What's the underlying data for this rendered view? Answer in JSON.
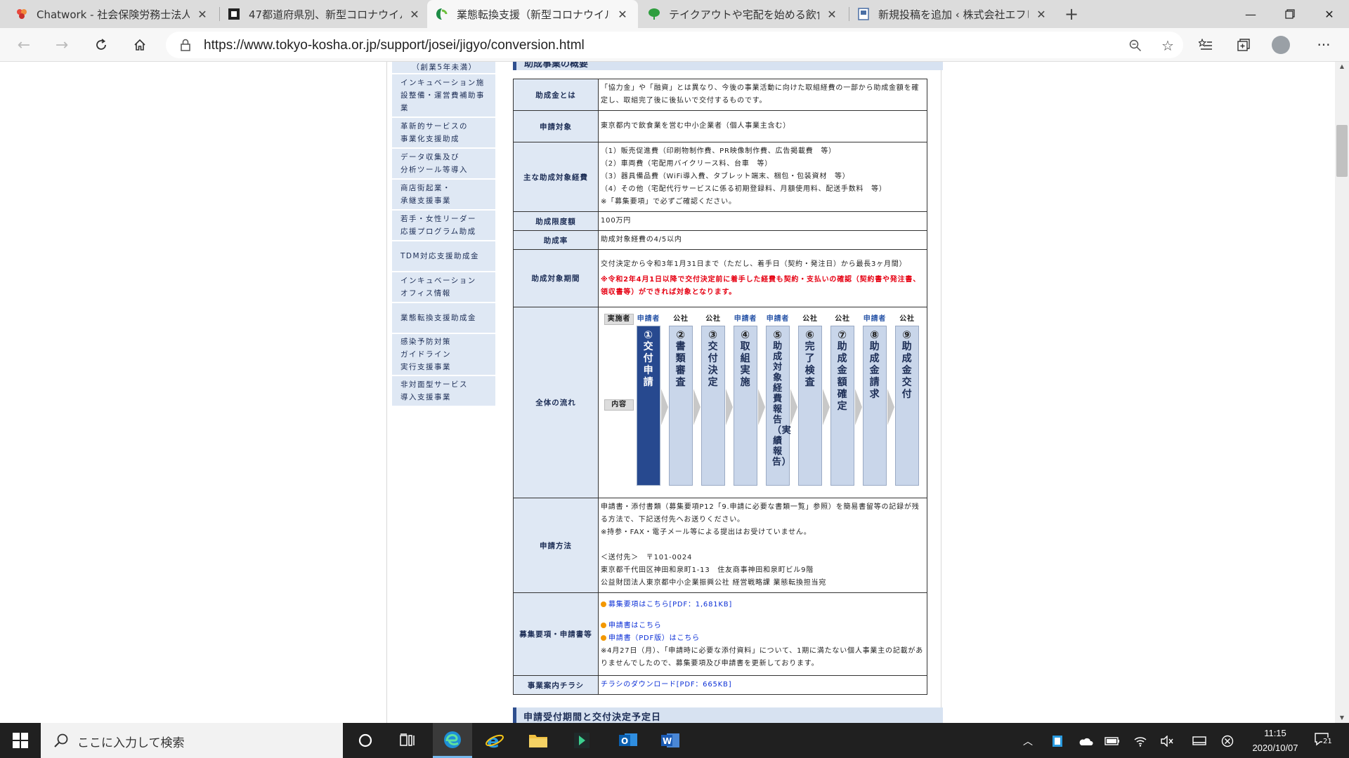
{
  "browser": {
    "tabs": [
      {
        "title": "Chatwork - 社会保険労務士法人い",
        "icon": "chatwork-icon"
      },
      {
        "title": "47都道府県別、新型コロナウイルス",
        "icon": "square-favicon-icon"
      },
      {
        "title": "業態転換支援（新型コロナウイルス",
        "icon": "kosha-favicon-icon"
      },
      {
        "title": "テイクアウトや宅配を始める飲食店の",
        "icon": "green-leaf-icon"
      },
      {
        "title": "新規投稿を追加 ‹ 株式会社エフピー",
        "icon": "document-favicon-icon"
      }
    ],
    "url": "https://www.tokyo-kosha.or.jp/support/josei/jigyo/conversion.html"
  },
  "sidebar": {
    "items": [
      {
        "lines": [
          "（創業5年未満）"
        ]
      },
      {
        "lines": [
          "インキュベーション施",
          "設整備・運営費補助事",
          "業"
        ]
      },
      {
        "lines": [
          "革新的サービスの",
          "事業化支援助成"
        ]
      },
      {
        "lines": [
          "データ収集及び",
          "分析ツール等導入"
        ]
      },
      {
        "lines": [
          "商店街起業・",
          "承継支援事業"
        ]
      },
      {
        "lines": [
          "若手・女性リーダー",
          "応援プログラム助成"
        ]
      },
      {
        "lines": [
          "TDM対応支援助成金"
        ]
      },
      {
        "lines": [
          "インキュベーション",
          "オフィス情報"
        ]
      },
      {
        "lines": [
          "業態転換支援助成金"
        ]
      },
      {
        "lines": [
          "感染予防対策",
          "ガイドライン",
          "実行支援事業"
        ]
      },
      {
        "lines": [
          "非対面型サービス",
          "導入支援事業"
        ]
      }
    ]
  },
  "section_top": {
    "title": "助成事業の概要"
  },
  "table": {
    "rows": {
      "overview": {
        "label": "助成金とは",
        "text": "「協力金」や「融資」とは異なり、今後の事業活動に向けた取組経費の一部から助成金額を確定し、取組完了後に後払いで交付するものです。"
      },
      "target": {
        "label": "申請対象",
        "text": "東京都内で飲食業を営む中小企業者（個人事業主含む）"
      },
      "expenses": {
        "label": "主な助成対象経費",
        "lines": [
          "（1）販売促進費（印刷物制作費、PR映像制作費、広告掲載費　等）",
          "（2）車両費（宅配用バイクリース料、台車　等）",
          "（3）器具備品費（WiFi導入費、タブレット端末、梱包・包装資材　等）",
          "（4）その他（宅配代行サービスに係る初期登録料、月額使用料、配送手数料　等）",
          "※「募集要項」で必ずご確認ください。"
        ]
      },
      "limit": {
        "label": "助成限度額",
        "text": "100万円"
      },
      "rate": {
        "label": "助成率",
        "text": "助成対象経費の4/5以内"
      },
      "period": {
        "label": "助成対象期間",
        "text": "交付決定から令和3年1月31日まで（ただし、着手日（契約・発注日）から最長3ヶ月間）",
        "note": "※令和2年4月1日以降で交付決定前に着手した経費も契約・支払いの確認（契約書や発注書、領収書等）ができれば対象となります。"
      },
      "flow": {
        "label": "全体の流れ",
        "exec_label": "実施者",
        "content_label": "内容",
        "steps": [
          {
            "actor": "申請者",
            "num": "①",
            "label": "交付申請"
          },
          {
            "actor": "公社",
            "num": "②",
            "label": "書類審査"
          },
          {
            "actor": "公社",
            "num": "③",
            "label": "交付決定"
          },
          {
            "actor": "申請者",
            "num": "④",
            "label": "取組実施"
          },
          {
            "actor": "申請者",
            "num": "⑤",
            "label": "助成対象経費報告（実績報告）"
          },
          {
            "actor": "公社",
            "num": "⑥",
            "label": "完了検査"
          },
          {
            "actor": "公社",
            "num": "⑦",
            "label": "助成金額確定"
          },
          {
            "actor": "申請者",
            "num": "⑧",
            "label": "助成金請求"
          },
          {
            "actor": "公社",
            "num": "⑨",
            "label": "助成金交付"
          }
        ]
      },
      "method": {
        "label": "申請方法",
        "lines": [
          "申請書・添付書類（募集要項P12「9.申請に必要な書類一覧」参照）を簡易書留等の記録が残る方法で、下記送付先へお送りください。",
          "※持参・FAX・電子メール等による提出はお受けていません。",
          "",
          "＜送付先＞　〒101-0024",
          "東京都千代田区神田和泉町1-13　住友商事神田和泉町ビル9階",
          "公益財団法人東京都中小企業振興公社 経営戦略課 業態転換担当宛"
        ]
      },
      "docs": {
        "label": "募集要項・申請書等",
        "link1": "募集要項はこちら[PDF：1,681KB]",
        "link2": "申請書はこちら",
        "link3": "申請書（PDF版）はこちら",
        "note": "※4月27日（月）、「申請時に必要な添付資料」について、1期に満たない個人事業主の記載がありませんでしたので、募集要項及び申請書を更新しております。"
      },
      "flyer": {
        "label": "事業案内チラシ",
        "link": "チラシのダウンロード[PDF：665KB]"
      }
    }
  },
  "section_next": {
    "title": "申請受付期間と交付決定予定日"
  },
  "taskbar": {
    "search_placeholder": "ここに入力して検索",
    "time": "11:15",
    "date": "2020/10/07",
    "notifications": "21"
  }
}
